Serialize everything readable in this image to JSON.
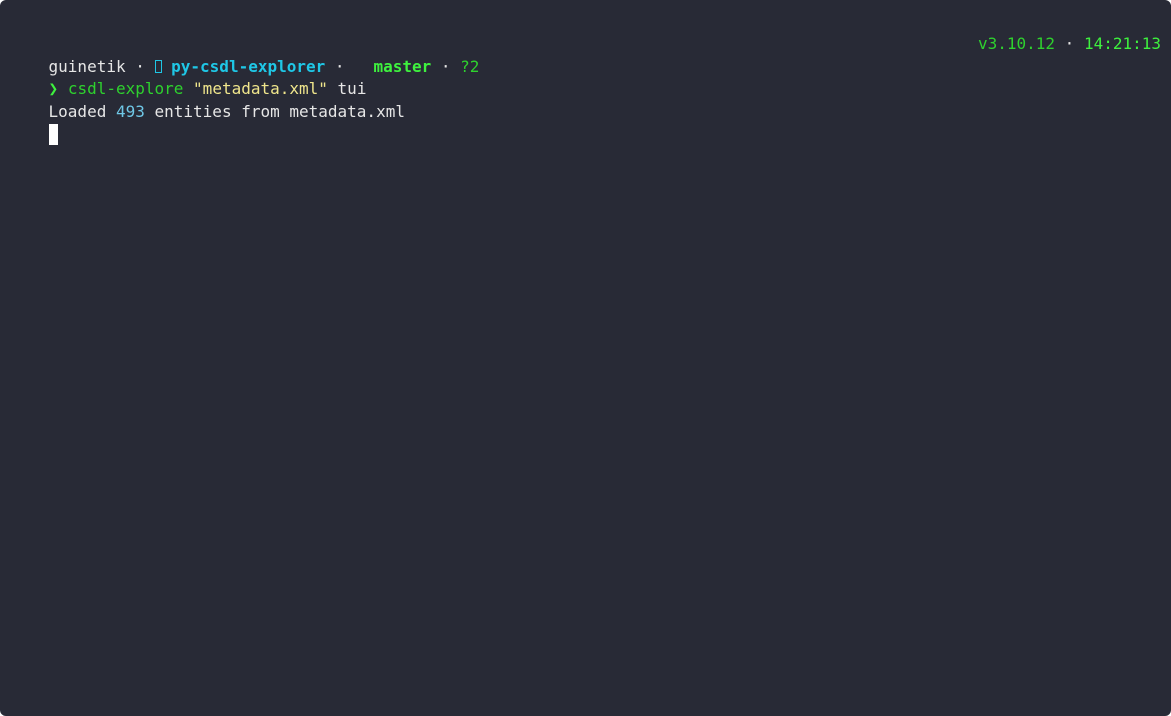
{
  "prompt": {
    "user": "guinetik",
    "sep": " · ",
    "dir": "py-csdl-explorer",
    "sep2": " · ",
    "branch": "master",
    "sep3": " · ",
    "status": "?2",
    "python_version": "v3.10.12",
    "sep4": " · ",
    "time": "14:21:13",
    "symbol": "❯"
  },
  "command": {
    "program": "csdl-explore",
    "argument": "\"metadata.xml\"",
    "subcommand": "tui"
  },
  "output": {
    "prefix": "Loaded ",
    "count": "493",
    "suffix": " entities from metadata.xml"
  },
  "colors": {
    "background": "#282a36",
    "foreground": "#e6e6e6",
    "dir": "#1fc7e6",
    "green": "#2ed12e",
    "green_bright": "#3ef13e",
    "string": "#f0e68c",
    "number": "#6fc7e6",
    "cursor": "#ffffff"
  }
}
